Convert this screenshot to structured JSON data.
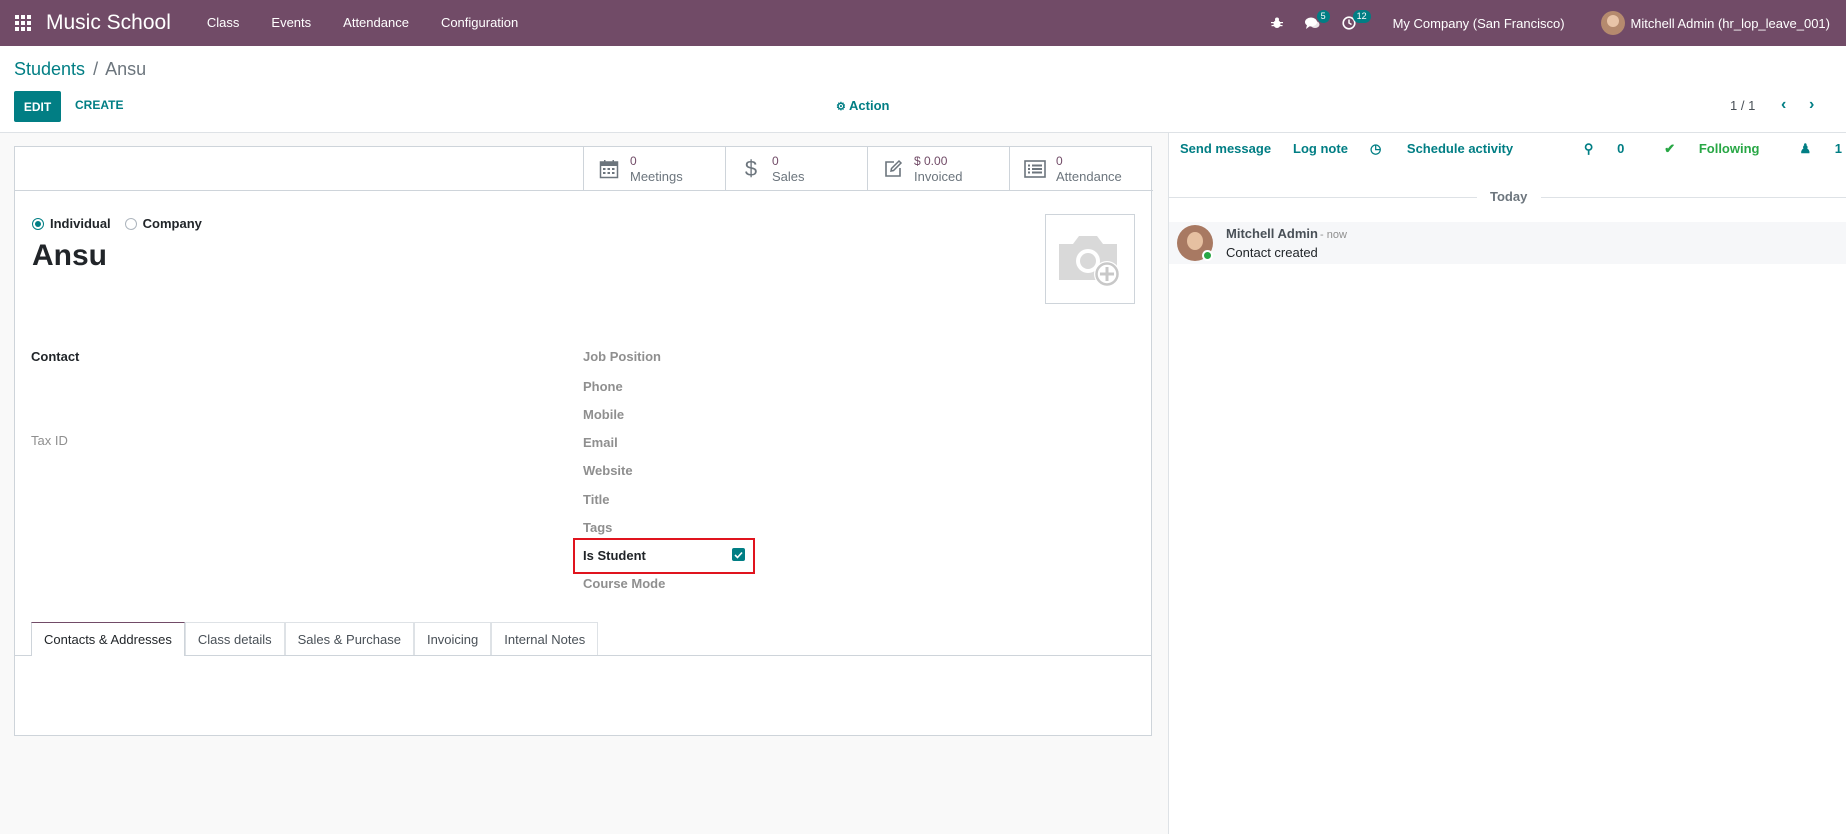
{
  "navbar": {
    "brand": "Music School",
    "menu": [
      "Class",
      "Events",
      "Attendance",
      "Configuration"
    ],
    "messages_badge": "5",
    "activities_badge": "12",
    "company": "My Company (San Francisco)",
    "user": "Mitchell Admin (hr_lop_leave_001)"
  },
  "control_panel": {
    "breadcrumb_parent": "Students",
    "breadcrumb_sep": "/",
    "breadcrumb_current": "Ansu",
    "edit_label": "EDIT",
    "create_label": "CREATE",
    "action_label": "Action",
    "pager": "1 / 1"
  },
  "stat_buttons": [
    {
      "value": "0",
      "label": "Meetings",
      "icon": "calendar-icon"
    },
    {
      "value": "0",
      "label": "Sales",
      "icon": "dollar-icon"
    },
    {
      "value": "$ 0.00",
      "label": "Invoiced",
      "icon": "pencil-square-icon"
    },
    {
      "value": "0",
      "label": "Attendance",
      "icon": "list-alt-icon"
    }
  ],
  "form": {
    "type_individual": "Individual",
    "type_company": "Company",
    "name": "Ansu",
    "contact_label": "Contact",
    "tax_id_label": "Tax ID",
    "job_position_placeholder": "Job Position",
    "phone_label": "Phone",
    "mobile_label": "Mobile",
    "email_label": "Email",
    "website_label": "Website",
    "title_label": "Title",
    "tags_label": "Tags",
    "is_student_label": "Is Student",
    "is_student_checked": true,
    "course_mode_label": "Course Mode"
  },
  "tabs": [
    "Contacts & Addresses",
    "Class details",
    "Sales & Purchase",
    "Invoicing",
    "Internal Notes"
  ],
  "chatter": {
    "send_message": "Send message",
    "log_note": "Log note",
    "schedule_activity": "Schedule activity",
    "attachments": "0",
    "following": "Following",
    "followers": "1",
    "date_separator": "Today",
    "message_author": "Mitchell Admin",
    "message_time": "- now",
    "message_body": "Contact created"
  },
  "colors": {
    "navbar": "#714B67",
    "accent": "#017e84",
    "highlight_box": "#e0141e",
    "following": "#28a745"
  }
}
